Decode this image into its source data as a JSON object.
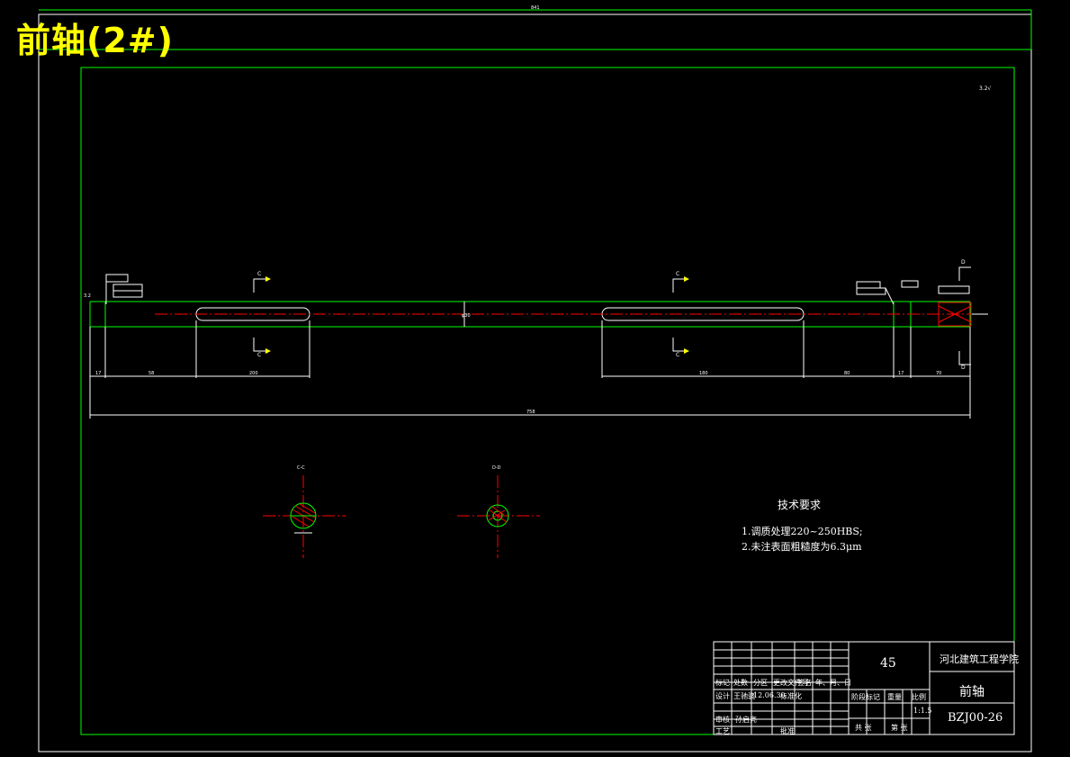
{
  "overlay_title": "前轴(2#)",
  "frame_top_dim": "841",
  "technical_requirements": {
    "heading": "技术要求",
    "items": [
      "1.调质处理220~250HBS;",
      "2.未注表面粗糙度为6.3μm"
    ]
  },
  "title_block": {
    "material": "45",
    "school": "河北建筑工程学院",
    "part_name": "前轴",
    "drawing_no": "BZJ00-26",
    "scale": "1:1.5",
    "row_labels": [
      "标记",
      "处数",
      "分区",
      "更改文件号",
      "签名",
      "年、月、日"
    ],
    "design_row": [
      "设计",
      "王驰骁",
      "12.06.30",
      "标准化"
    ],
    "check_row": [
      "审核",
      "孙启亮"
    ],
    "process_row": [
      "工艺",
      "批准"
    ],
    "stage_row": [
      "阶段标记",
      "重量",
      "比例"
    ],
    "sheets": [
      "共 张",
      "第 张"
    ]
  },
  "dimensions": {
    "segments": [
      "17",
      "58",
      "200",
      "180",
      "80",
      "17",
      "70"
    ],
    "overall": "758",
    "diameter": "φ30",
    "roughness": "3.2",
    "section_labels": [
      "C",
      "C",
      "C",
      "C",
      "D",
      "D"
    ],
    "section_views": [
      "C-C",
      "D-D"
    ]
  }
}
